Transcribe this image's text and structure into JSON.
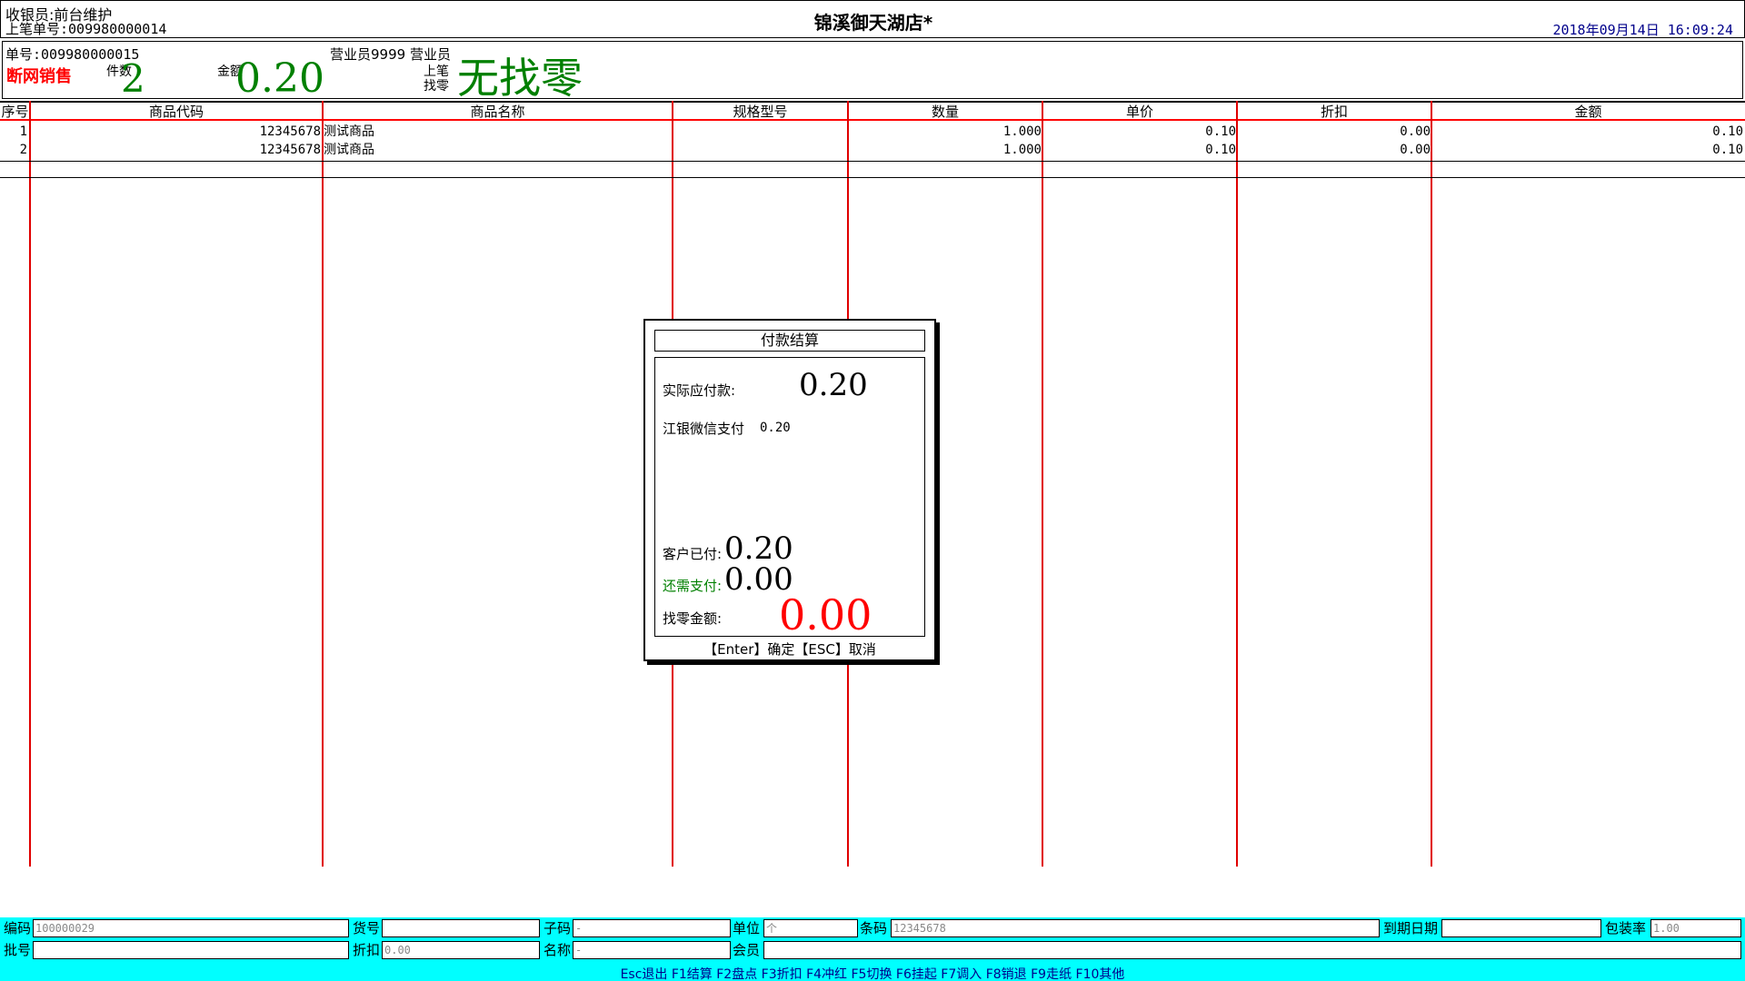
{
  "header": {
    "cashier": "收银员:前台维护",
    "last_bill": "上笔单号:009980000014",
    "store_name": "锦溪御天湖店*",
    "datetime": "2018年09月14日 16:09:24"
  },
  "info": {
    "bill_no": "单号:009980000015",
    "staff": "营业员9999 营业员",
    "mode": "断网销售",
    "count_label": "件数",
    "count_value": "2",
    "amount_label": "金额",
    "amount_value": "0.20",
    "change_label": "上笔找零",
    "change_value": "无找零"
  },
  "table": {
    "columns": [
      "序号",
      "商品代码",
      "商品名称",
      "规格型号",
      "数量",
      "单价",
      "折扣",
      "金额"
    ],
    "rows": [
      {
        "no": "1",
        "code": "12345678",
        "name": "测试商品",
        "spec": "",
        "qty": "1.000",
        "price": "0.10",
        "discount": "0.00",
        "amount": "0.10"
      },
      {
        "no": "2",
        "code": "12345678",
        "name": "测试商品",
        "spec": "",
        "qty": "1.000",
        "price": "0.10",
        "discount": "0.00",
        "amount": "0.10"
      }
    ]
  },
  "dialog": {
    "title": "付款结算",
    "due_label": "实际应付款:",
    "due_value": "0.20",
    "payment_method": "江银微信支付",
    "payment_amount": "0.20",
    "paid_label": "客户已付:",
    "paid_value": "0.20",
    "need_label": "还需支付:",
    "need_value": "0.00",
    "change_label": "找零金额:",
    "change_value": "0.00",
    "hint": "【Enter】确定【ESC】取消"
  },
  "form": {
    "code_label": "编码",
    "code_value": "100000029",
    "item_no_label": "货号",
    "item_no_value": "",
    "subcode_label": "子码",
    "subcode_value": "-",
    "unit_label": "单位",
    "unit_value": "个",
    "barcode_label": "条码",
    "barcode_value": "12345678",
    "expiry_label": "到期日期",
    "expiry_value": "",
    "pack_label": "包装率",
    "pack_value": "1.00",
    "batch_label": "批号",
    "batch_value": "",
    "discount_label": "折扣",
    "discount_value": "0.00",
    "name_label": "名称",
    "name_value": "-",
    "member_label": "会员",
    "member_value": ""
  },
  "function_keys": "Esc退出 F1结算 F2盘点 F3折扣 F4冲红 F5切换 F6挂起 F7调入 F8销退 F9走纸 F10其他",
  "colors": {
    "grid_line": "#e00000",
    "accent_green": "#008000",
    "alert_red": "#ff0000",
    "bottom_bar": "#00ffff"
  }
}
